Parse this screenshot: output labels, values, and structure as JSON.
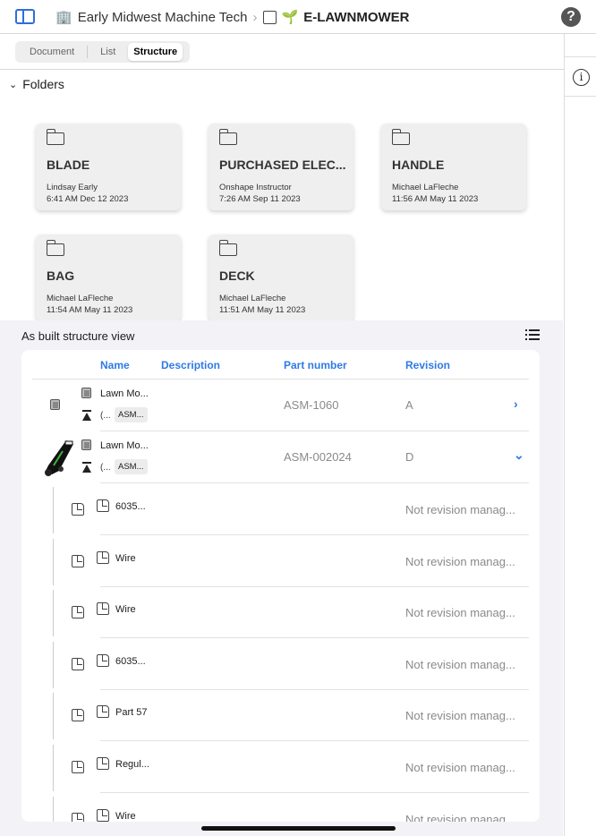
{
  "header": {
    "workspace": "Early Midwest Machine Tech",
    "document": "E-LAWNMOWER",
    "help_icon": "question-circle-icon",
    "sidebar_icon": "sidebar-toggle-icon"
  },
  "tabs": [
    {
      "label": "Document",
      "active": false
    },
    {
      "label": "List",
      "active": false
    },
    {
      "label": "Structure",
      "active": true
    }
  ],
  "folders": {
    "title": "Folders",
    "items": [
      {
        "name": "BLADE",
        "user": "Lindsay Early",
        "date": "6:41 AM Dec 12 2023"
      },
      {
        "name": "PURCHASED ELEC...",
        "user": "Onshape Instructor",
        "date": "7:26 AM Sep 11 2023"
      },
      {
        "name": "HANDLE",
        "user": "Michael LaFleche",
        "date": "11:56 AM May 11 2023"
      },
      {
        "name": "BAG",
        "user": "Michael LaFleche",
        "date": "11:54 AM May 11 2023"
      },
      {
        "name": "DECK",
        "user": "Michael LaFleche",
        "date": "11:51 AM May 11 2023"
      }
    ]
  },
  "structure": {
    "title": "As built structure view",
    "columns": {
      "name": "Name",
      "description": "Description",
      "part_number": "Part number",
      "revision": "Revision"
    },
    "assemblies": [
      {
        "name": "Lawn Mo...",
        "version": "(...",
        "badge": "ASM...",
        "part_number": "ASM-1060",
        "revision": "A",
        "expanded": false
      },
      {
        "name": "Lawn Mo...",
        "version": "(...",
        "badge": "ASM...",
        "part_number": "ASM-002024",
        "revision": "D",
        "expanded": true
      }
    ],
    "parts": [
      {
        "name": "6035...",
        "revision": "Not revision manag..."
      },
      {
        "name": "Wire",
        "revision": "Not revision manag..."
      },
      {
        "name": "Wire",
        "revision": "Not revision manag..."
      },
      {
        "name": "6035...",
        "revision": "Not revision manag..."
      },
      {
        "name": "Part 57",
        "revision": "Not revision manag..."
      },
      {
        "name": "Regul...",
        "revision": "Not revision manag..."
      },
      {
        "name": "Wire",
        "revision": "Not revision manag..."
      }
    ]
  },
  "colors": {
    "accent": "#2f7ae5",
    "brand_leaf": "#3cb043"
  }
}
